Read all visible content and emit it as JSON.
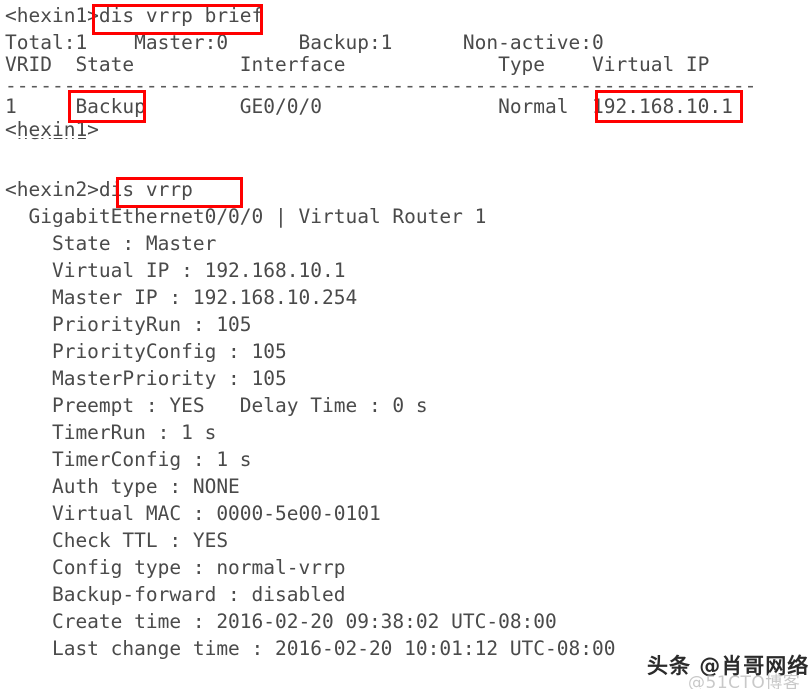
{
  "terminal": {
    "block1": {
      "prompt_line": "<hexin1>dis vrrp brief",
      "summary_line": "Total:1    Master:0      Backup:1      Non-active:0",
      "header_line": "VRID  State         Interface             Type    Virtual IP",
      "separator_line": "----------------------------------------------------------------",
      "row_line": "1     Backup        GE0/0/0               Normal  192.168.10.1",
      "end_prompt": "<hexin1>",
      "clipped_line": "<hexin1>"
    },
    "block2": {
      "prompt_line": "<hexin2>dis vrrp",
      "lines": [
        "  GigabitEthernet0/0/0 | Virtual Router 1",
        "    State : Master",
        "    Virtual IP : 192.168.10.1",
        "    Master IP : 192.168.10.254",
        "    PriorityRun : 105",
        "    PriorityConfig : 105",
        "    MasterPriority : 105",
        "    Preempt : YES   Delay Time : 0 s",
        "    TimerRun : 1 s",
        "    TimerConfig : 1 s",
        "    Auth type : NONE",
        "    Virtual MAC : 0000-5e00-0101",
        "    Check TTL : YES",
        "    Config type : normal-vrrp",
        "    Backup-forward : disabled",
        "    Create time : 2016-02-20 09:38:02 UTC-08:00",
        "    Last change time : 2016-02-20 10:01:12 UTC-08:00"
      ]
    },
    "fields": {
      "total": "1",
      "master_count": "0",
      "backup_count": "1",
      "non_active": "0",
      "vrid": "1",
      "state_brief": "Backup",
      "interface_brief": "GE0/0/0",
      "type_brief": "Normal",
      "virtual_ip_brief": "192.168.10.1",
      "interface_full": "GigabitEthernet0/0/0",
      "virtual_router": "1",
      "state": "Master",
      "virtual_ip": "192.168.10.1",
      "master_ip": "192.168.10.254",
      "priority_run": "105",
      "priority_config": "105",
      "master_priority": "105",
      "preempt": "YES",
      "delay_time": "0 s",
      "timer_run": "1 s",
      "timer_config": "1 s",
      "auth_type": "NONE",
      "virtual_mac": "0000-5e00-0101",
      "check_ttl": "YES",
      "config_type": "normal-vrrp",
      "backup_forward": "disabled",
      "create_time": "2016-02-20 09:38:02 UTC-08:00",
      "last_change_time": "2016-02-20 10:01:12 UTC-08:00"
    }
  },
  "annotations": {
    "color": "#ff0000",
    "boxes": [
      {
        "label": "dis vrrp brief"
      },
      {
        "label": "Backup"
      },
      {
        "label": "192.168.10.1"
      },
      {
        "label": "dis vrrp"
      }
    ]
  },
  "watermarks": {
    "primary": "头条 @肖哥网络技术",
    "secondary": "@51CTO博客"
  }
}
